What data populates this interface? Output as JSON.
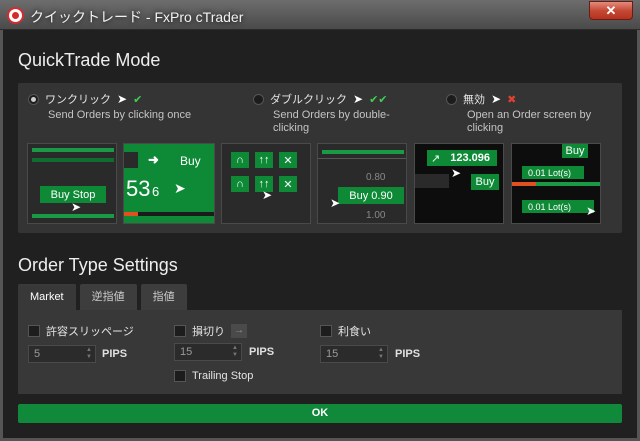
{
  "window": {
    "title": "クイックトレード - FxPro cTrader",
    "close_label": "✕"
  },
  "quicktrade": {
    "heading": "QuickTrade Mode",
    "options": [
      {
        "label": "ワンクリック",
        "description": "Send Orders by clicking once",
        "selected": true
      },
      {
        "label": "ダブルクリック",
        "description": "Send Orders by double-clicking",
        "selected": false
      },
      {
        "label": "無効",
        "description": "Open an Order screen by clicking",
        "selected": false
      }
    ],
    "previews": {
      "buy_stop": "Buy Stop",
      "buy": "Buy",
      "price_big": "53",
      "price_small": "6",
      "buy_090": "Buy  0.90",
      "level_080": "0.80",
      "level_100": "1.00",
      "quote": "123.096",
      "buy_small": "Buy",
      "lot_1": "0.01 Lot(s)",
      "lot_2": "0.01 Lot(s)"
    }
  },
  "order_type": {
    "heading": "Order Type Settings",
    "tabs": [
      "Market",
      "逆指値",
      "指値"
    ],
    "active_tab": 0,
    "slippage_label": "許容スリッページ",
    "slippage_value": "5",
    "stoploss_label": "損切り",
    "stoploss_value": "15",
    "takeprofit_label": "利食い",
    "takeprofit_value": "15",
    "trailing_label": "Trailing Stop",
    "pips_label": "PIPS"
  },
  "ok_label": "OK",
  "colors": {
    "accent_green": "#10893a",
    "close_red": "#c44a35"
  }
}
